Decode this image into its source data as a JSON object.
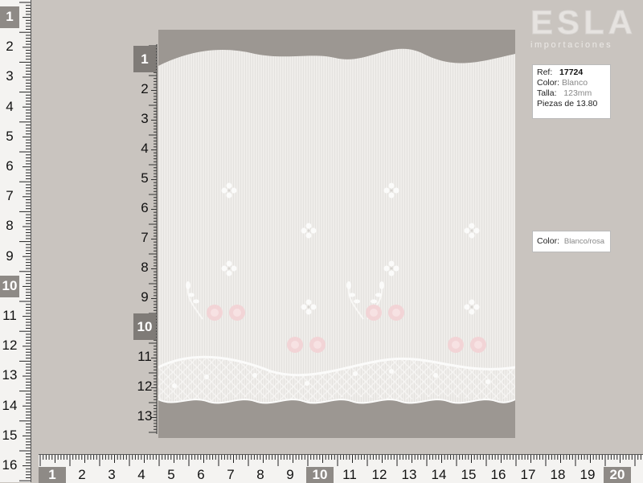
{
  "logo": {
    "main": "ESLA",
    "sub": "importaciones"
  },
  "info": {
    "ref_label": "Ref:",
    "ref_value": "17724",
    "color_label": "Color:",
    "color_value": "Blanco",
    "talla_label": "Talla:",
    "talla_value": "123mm",
    "piezas": "Piezas de 13.80"
  },
  "color_option": {
    "label": "Color:",
    "value": "Blanco/rosa"
  },
  "left_ruler": [
    "1",
    "2",
    "3",
    "4",
    "5",
    "6",
    "7",
    "8",
    "9",
    "10",
    "11",
    "12",
    "13",
    "14",
    "15",
    "16"
  ],
  "bottom_ruler": [
    "1",
    "2",
    "3",
    "4",
    "5",
    "6",
    "7",
    "8",
    "9",
    "10",
    "11",
    "12",
    "13",
    "14",
    "15",
    "16",
    "17",
    "18",
    "19",
    "20"
  ],
  "inner_ruler": [
    "1",
    "2",
    "3",
    "4",
    "5",
    "6",
    "7",
    "8",
    "9",
    "10",
    "11",
    "12",
    "13"
  ],
  "colors": {
    "fabric": "#f1efec",
    "embroidery_pink": "#f2d4d6",
    "background": "#c9c4bf"
  }
}
